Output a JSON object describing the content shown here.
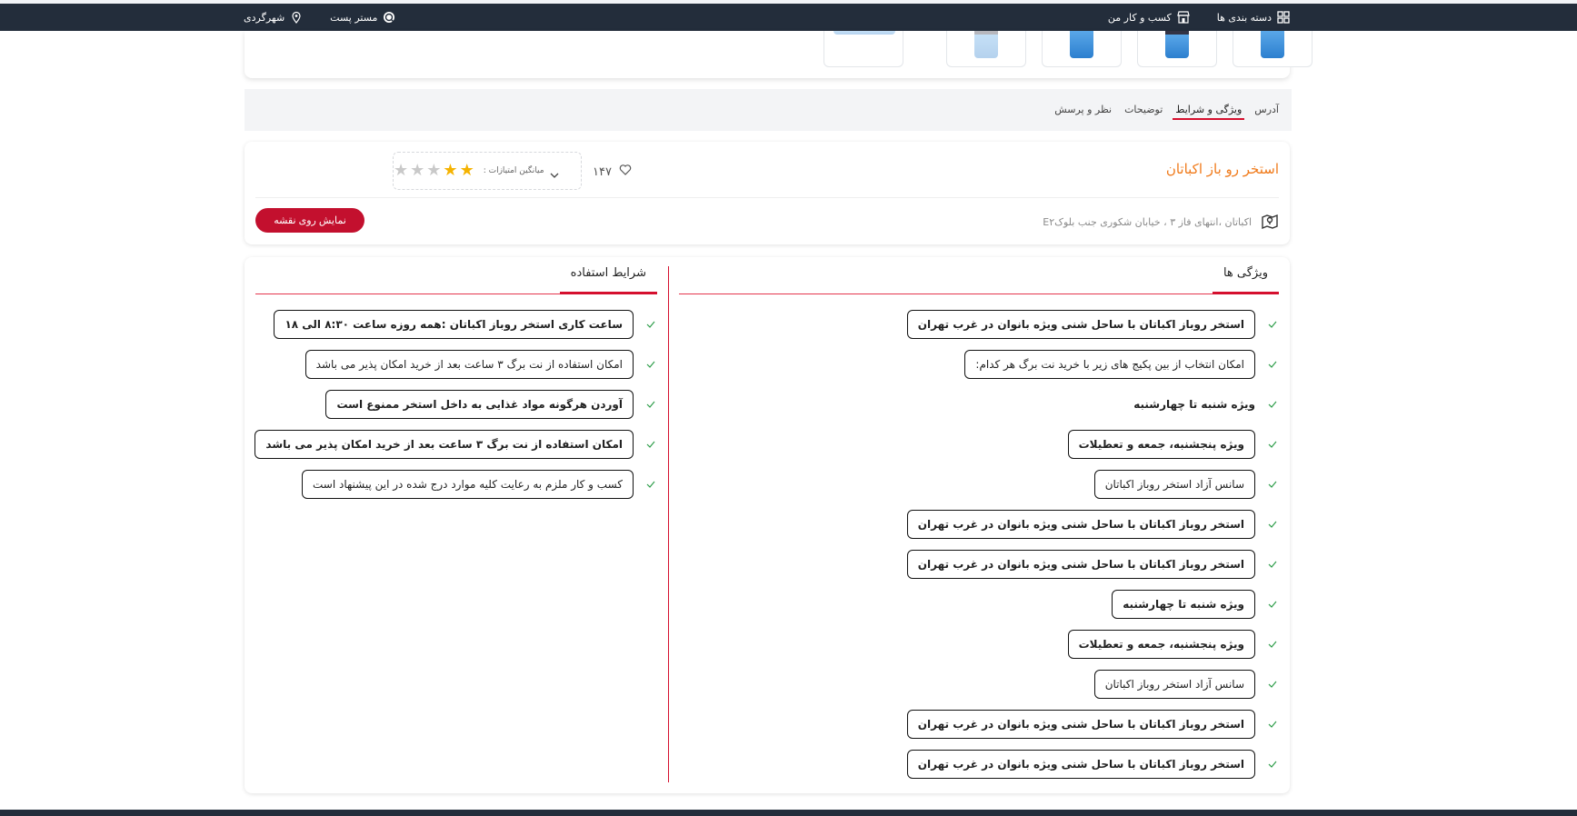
{
  "topbar": {
    "categories_label": "دسته بندی ها",
    "business_label": "کسب و کار من",
    "post_label": "مستر پست",
    "city_label": "شهرگردی"
  },
  "tabs": [
    {
      "label": "آدرس",
      "active": false
    },
    {
      "label": "ویژگی و شرایط",
      "active": true
    },
    {
      "label": "توضیحات",
      "active": false
    },
    {
      "label": "نظر و پرسش",
      "active": false
    }
  ],
  "place": {
    "title": "استخر رو باز اکباتان",
    "likes": "۱۴۷",
    "rating_label": "میانگین امتیازات :",
    "rating": 2,
    "rating_max": 5,
    "address": "اکباتان ،انتهای فاز ۳ ، خیابان شکوری جنب بلوکE۲",
    "map_button": "نمایش روی نقشه"
  },
  "features": {
    "heading": "ویژگی ها",
    "items": [
      {
        "text": "استخر روباز اکباتان با ساحل شنی ویژه بانوان در غرب تهران",
        "style": "bold-pill"
      },
      {
        "text": "امکان انتخاب از بین پکیج های زیر با خرید نت برگ هر کدام:",
        "style": "pill"
      },
      {
        "text": "ویژه شنبه تا چهارشنبه",
        "style": "plain"
      },
      {
        "text": "ویژه پنجشنبه، جمعه و تعطیلات",
        "style": "bold-pill"
      },
      {
        "text": "سانس آزاد استخر روباز اکباتان",
        "style": "pill"
      },
      {
        "text": "استخر روباز اکباتان با ساحل شنی ویژه بانوان در غرب تهران",
        "style": "bold-pill"
      },
      {
        "text": "استخر روباز اکباتان با ساحل شنی ویژه بانوان در غرب تهران",
        "style": "bold-pill"
      },
      {
        "text": "ویژه شنبه تا چهارشنبه",
        "style": "bold-pill"
      },
      {
        "text": "ویژه پنجشنبه، جمعه و تعطیلات",
        "style": "bold-pill"
      },
      {
        "text": "سانس آزاد استخر روباز اکباتان",
        "style": "pill"
      },
      {
        "text": "استخر روباز اکباتان با ساحل شنی ویژه بانوان در غرب تهران",
        "style": "bold-pill"
      },
      {
        "text": "استخر روباز اکباتان با ساحل شنی ویژه بانوان در غرب تهران",
        "style": "bold-pill"
      }
    ]
  },
  "terms": {
    "heading": "شرایط استفاده",
    "items": [
      {
        "text": "ساعت کاری استخر روباز اکباتان :همه روزه ساعت ۸:۳۰ الی ۱۸",
        "style": "bold-pill"
      },
      {
        "text": "امکان استفاده از نت برگ ۳ ساعت بعد از خرید امکان پذیر می باشد",
        "style": "pill"
      },
      {
        "text": "آوردن هرگونه مواد غذایی به داخل استخر ممنوع است",
        "style": "bold-pill"
      },
      {
        "text": "امکان استفاده از نت برگ ۳ ساعت بعد از خرید امکان پذیر می باشد",
        "style": "bold-pill"
      },
      {
        "text": "کسب و کار ملزم به رعایت کلیه موارد درج شده در این پیشنهاد است",
        "style": "pill"
      }
    ]
  },
  "colors": {
    "accent": "#d5102e",
    "title": "#f07a1a",
    "topbar": "#232d3b",
    "check": "#2e9d4a"
  }
}
